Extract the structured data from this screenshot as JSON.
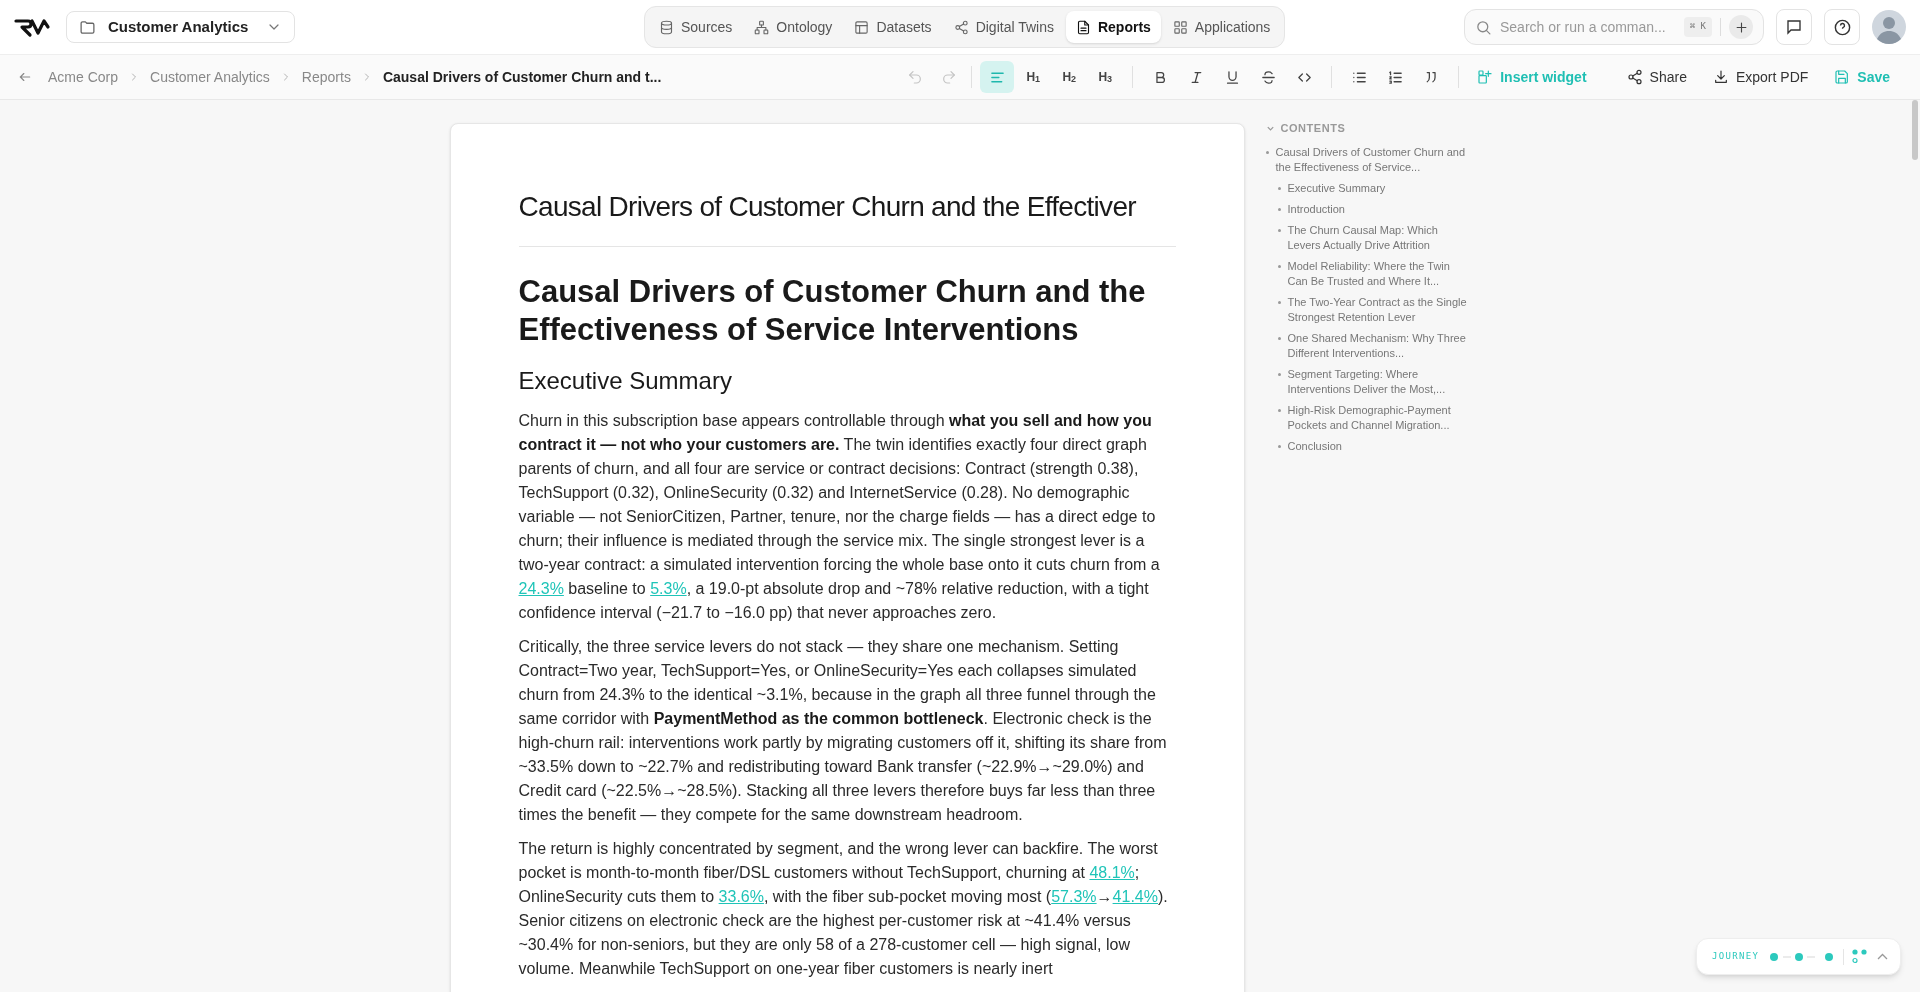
{
  "project_selector": {
    "label": "Customer Analytics"
  },
  "nav_tabs": [
    {
      "kind": "database",
      "label": "Sources",
      "selected": false
    },
    {
      "kind": "hierarchy",
      "label": "Ontology",
      "selected": false
    },
    {
      "kind": "table",
      "label": "Datasets",
      "selected": false
    },
    {
      "kind": "share",
      "label": "Digital Twins",
      "selected": false
    },
    {
      "kind": "document",
      "label": "Reports",
      "selected": true
    },
    {
      "kind": "grid",
      "label": "Applications",
      "selected": false
    }
  ],
  "search": {
    "placeholder": "Search or run a comman...",
    "shortcut": "⌘ K"
  },
  "breadcrumbs": [
    {
      "label": "Acme Corp",
      "current": false
    },
    {
      "label": "Customer Analytics",
      "current": false
    },
    {
      "label": "Reports",
      "current": false
    },
    {
      "label": "Causal Drivers of Customer Churn and t...",
      "current": true
    }
  ],
  "history_buttons": [
    {
      "kind": "undo",
      "disabled": true
    },
    {
      "kind": "redo",
      "disabled": true
    }
  ],
  "format_buttons": [
    {
      "kind": "align-left",
      "selected": true
    },
    {
      "kind": "heading",
      "label": "H$_{1}$",
      "selected": false
    },
    {
      "kind": "heading",
      "label": "H$_{2}$",
      "selected": false
    },
    {
      "kind": "heading",
      "label": "H$_{3}$",
      "selected": false
    },
    {
      "kind": "bold",
      "selected": false
    },
    {
      "kind": "italic",
      "selected": false
    },
    {
      "kind": "underline",
      "selected": false
    },
    {
      "kind": "strike",
      "selected": false
    },
    {
      "kind": "code",
      "selected": false
    },
    {
      "kind": "bullets",
      "selected": false
    },
    {
      "kind": "numbers",
      "selected": false
    },
    {
      "kind": "quote",
      "selected": false
    }
  ],
  "actions": [
    {
      "kind": "widget",
      "label": "Insert widget",
      "accent": true
    },
    {
      "kind": "share",
      "label": "Share",
      "accent": false
    },
    {
      "kind": "download",
      "label": "Export PDF",
      "accent": false
    },
    {
      "kind": "save",
      "label": "Save",
      "accent": true
    }
  ],
  "document": {
    "title": "Causal Drivers of Customer Churn and the Effectiver",
    "heading": "Causal Drivers of Customer Churn and the Effectiveness of Service Interventions",
    "section_heading": "Executive Summary",
    "paragraphs": [
      [
        {
          "kind": "text",
          "text": "Churn in this subscription base appears controllable through "
        },
        {
          "kind": "bold",
          "text": "what you sell and how you contract it — not who your customers are."
        },
        {
          "kind": "text",
          "text": " The twin identifies exactly four direct graph parents of churn, and all four are service or contract decisions: Contract (strength 0.38), TechSupport (0.32), OnlineSecurity (0.32) and InternetService (0.28). No demographic variable — not SeniorCitizen, Partner, tenure, nor the charge fields — has a direct edge to churn; their influence is mediated through the service mix. The single strongest lever is a two-year contract: a simulated intervention forcing the whole base onto it cuts churn from a "
        },
        {
          "kind": "link",
          "text": "24.3%"
        },
        {
          "kind": "text",
          "text": " baseline to "
        },
        {
          "kind": "link",
          "text": "5.3%"
        },
        {
          "kind": "text",
          "text": ", a 19.0-pt absolute drop and ~78% relative reduction, with a tight confidence interval (−21.7 to −16.0 pp) that never approaches zero."
        }
      ],
      [
        {
          "kind": "text",
          "text": "Critically, the three service levers do not stack — they share one mechanism. Setting Contract=Two year, TechSupport=Yes, or OnlineSecurity=Yes each collapses simulated churn from 24.3% to the identical ~3.1%, because in the graph all three funnel through the same corridor with "
        },
        {
          "kind": "bold",
          "text": "PaymentMethod as the common bottleneck"
        },
        {
          "kind": "text",
          "text": ". Electronic check is the high-churn rail: interventions work partly by migrating customers off it, shifting its share from ~33.5% down to ~22.7% and redistributing toward Bank transfer (~22.9%→~29.0%) and Credit card (~22.5%→~28.5%). Stacking all three levers therefore buys far less than three times the benefit — they compete for the same downstream headroom."
        }
      ],
      [
        {
          "kind": "text",
          "text": "The return is highly concentrated by segment, and the wrong lever can backfire. The worst pocket is month-to-month fiber/DSL customers without TechSupport, churning at "
        },
        {
          "kind": "link",
          "text": "48.1%"
        },
        {
          "kind": "text",
          "text": "; OnlineSecurity cuts them to "
        },
        {
          "kind": "link",
          "text": "33.6%"
        },
        {
          "kind": "text",
          "text": ", with the fiber sub-pocket moving most ("
        },
        {
          "kind": "link",
          "text": "57.3%"
        },
        {
          "kind": "text",
          "text": "→"
        },
        {
          "kind": "link",
          "text": "41.4%"
        },
        {
          "kind": "text",
          "text": "). Senior citizens on electronic check are the highest per-customer risk at ~41.4% versus ~30.4% for non-seniors, but they are only 58 of a 278-customer cell — high signal, low volume. Meanwhile TechSupport on one-year fiber customers is nearly inert"
        }
      ]
    ]
  },
  "contents": {
    "title": "CONTENTS",
    "expanded": true,
    "items": [
      {
        "label": "Causal Drivers of Customer Churn and the Effectiveness of Service...",
        "children": [
          {
            "label": "Executive Summary"
          },
          {
            "label": "Introduction"
          },
          {
            "label": "The Churn Causal Map: Which Levers Actually Drive Attrition"
          },
          {
            "label": "Model Reliability: Where the Twin Can Be Trusted and Where It..."
          },
          {
            "label": "The Two-Year Contract as the Single Strongest Retention Lever"
          },
          {
            "label": "One Shared Mechanism: Why Three Different Interventions..."
          },
          {
            "label": "Segment Targeting: Where Interventions Deliver the Most,..."
          },
          {
            "label": "High-Risk Demographic-Payment Pockets and Channel Migration..."
          },
          {
            "label": "Conclusion"
          }
        ]
      }
    ]
  },
  "journey": {
    "label": "JOURNEY"
  }
}
